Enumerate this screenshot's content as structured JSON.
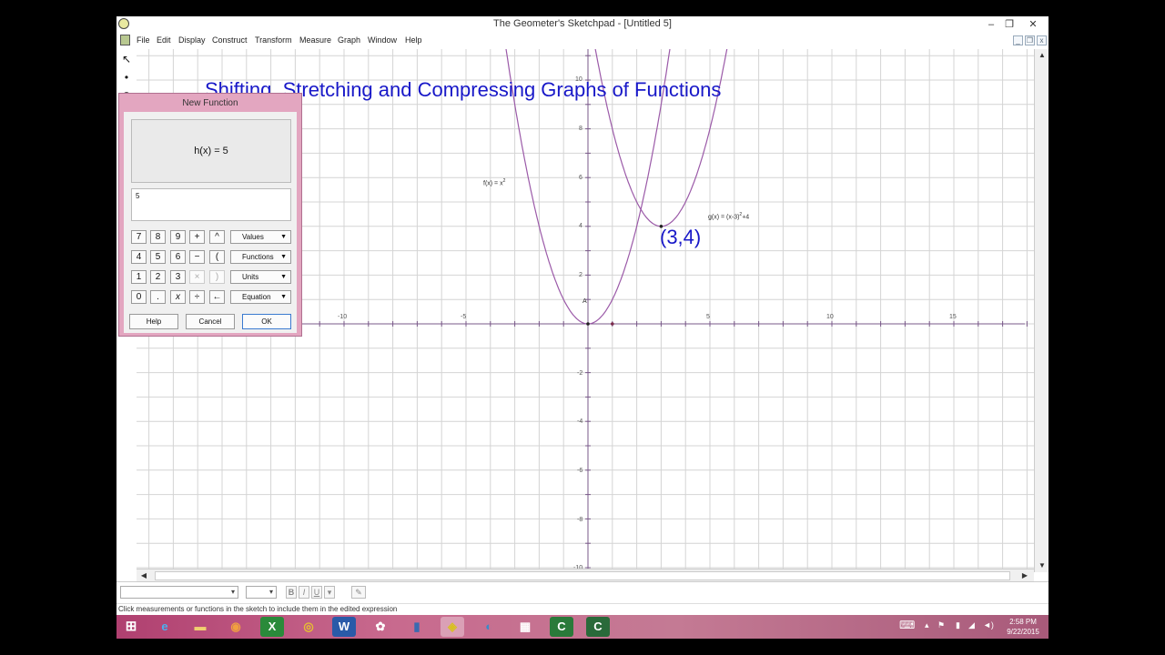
{
  "window": {
    "title": "The Geometer's Sketchpad - [Untitled 5]",
    "controls": [
      "–",
      "❐",
      "✕"
    ]
  },
  "menubar": {
    "items": [
      "File",
      "Edit",
      "Display",
      "Construct",
      "Transform",
      "Measure",
      "Graph",
      "Window",
      "Help"
    ],
    "doc_controls": [
      "_",
      "❐",
      "x"
    ]
  },
  "sketch": {
    "title": "Shifting, Stretching and Compressing Graphs of Functions",
    "f_label": "f(x) = x",
    "f_exp": "2",
    "g_label_pre": "g(x) = (x-3)",
    "g_exp": "2",
    "g_label_post": "+4",
    "vertex_label": "(3,4)",
    "point_label": "A",
    "x_ticks": [
      "-10",
      "-5",
      "5",
      "10",
      "15"
    ],
    "y_ticks": [
      "10",
      "8",
      "6",
      "4",
      "2",
      "-2",
      "-4",
      "-6",
      "-8",
      "-10"
    ],
    "colors": {
      "title": "#1818c8",
      "curve": "#9b5aa8",
      "grid": "#d4d4d4",
      "axis": "#7a5a8a"
    }
  },
  "dialog": {
    "title": "New Function",
    "preview": "h(x) = 5",
    "expression": "5",
    "keypad": [
      [
        "7",
        "8",
        "9",
        "+",
        "^"
      ],
      [
        "4",
        "5",
        "6",
        "−",
        "("
      ],
      [
        "1",
        "2",
        "3",
        "×",
        ")"
      ],
      [
        "0",
        ".",
        "x",
        "÷",
        "←"
      ]
    ],
    "dropdowns": [
      "Values",
      "Functions",
      "Units",
      "Equation"
    ],
    "buttons": {
      "help": "Help",
      "cancel": "Cancel",
      "ok": "OK"
    }
  },
  "text_palette": {
    "bold": "B",
    "italic": "I",
    "underline": "U"
  },
  "status": {
    "text": "Click measurements or functions in the sketch to include them in the edited expression"
  },
  "taskbar": {
    "clock_time": "2:58 PM",
    "clock_date": "9/22/2015"
  }
}
